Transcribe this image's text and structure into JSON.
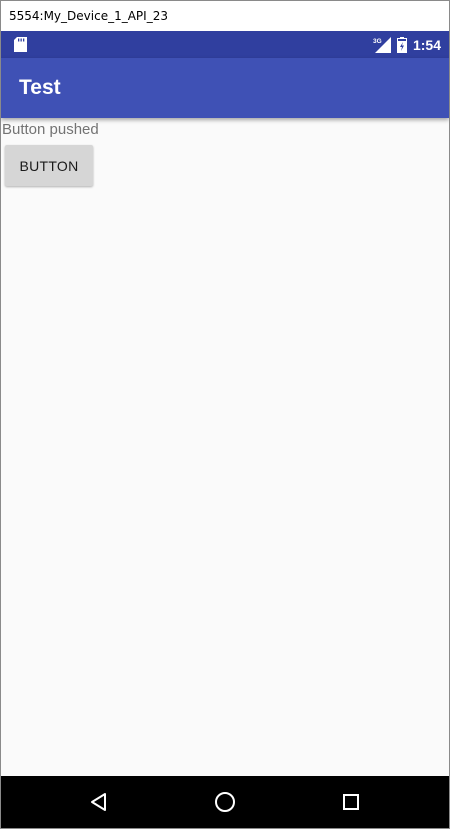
{
  "window": {
    "title": "5554:My_Device_1_API_23"
  },
  "status_bar": {
    "time": "1:54",
    "network": "3G",
    "background_color": "#303f9f"
  },
  "app_bar": {
    "title": "Test",
    "background_color": "#3f51b5"
  },
  "content": {
    "status_text": "Button pushed",
    "button_label": "BUTTON"
  },
  "nav_bar": {
    "back_icon": "back-triangle-icon",
    "home_icon": "home-circle-icon",
    "recent_icon": "recent-apps-square-icon"
  }
}
